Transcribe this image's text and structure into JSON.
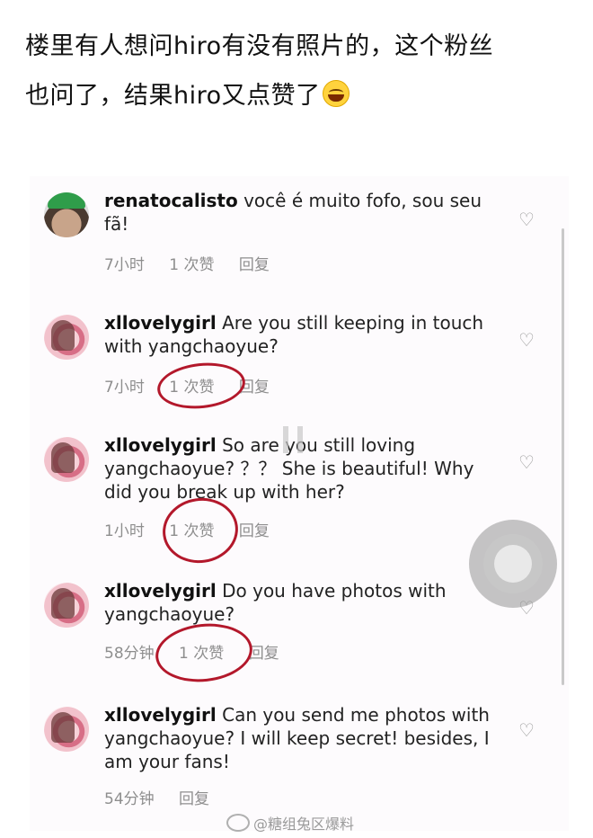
{
  "caption": {
    "line1": "楼里有人想问hiro有没有照片的，这个粉丝",
    "line2": "也问了，结果hiro又点赞了",
    "emoji": "laughing-tears-emoji"
  },
  "comments": [
    {
      "username": "renatocalisto",
      "text": "você é muito fofo, sou seu fã!",
      "time": "7小时",
      "likes": "1 次赞",
      "reply": "回复"
    },
    {
      "username": "xllovelygirl",
      "text": "Are you still keeping in touch with yangchaoyue?",
      "time": "7小时",
      "likes": "1 次赞",
      "reply": "回复"
    },
    {
      "username": "xllovelygirl",
      "text": "So are you still loving yangchaoyue? ？？ She is beautiful! Why did you break up with her?",
      "time": "1小时",
      "likes": "1 次赞",
      "reply": "回复"
    },
    {
      "username": "xllovelygirl",
      "text": "Do you have photos with yangchaoyue?",
      "time": "58分钟",
      "likes": "1 次赞",
      "reply": "回复"
    },
    {
      "username": "xllovelygirl",
      "text": "Can you send me photos with yangchaoyue? I will keep secret! besides, I am your fans!",
      "time": "54分钟",
      "reply": "回复"
    }
  ],
  "watermark": "@糖组兔区爆料",
  "colors": {
    "highlight_circle": "#b3182b",
    "meta_text": "#8e8e8e"
  }
}
